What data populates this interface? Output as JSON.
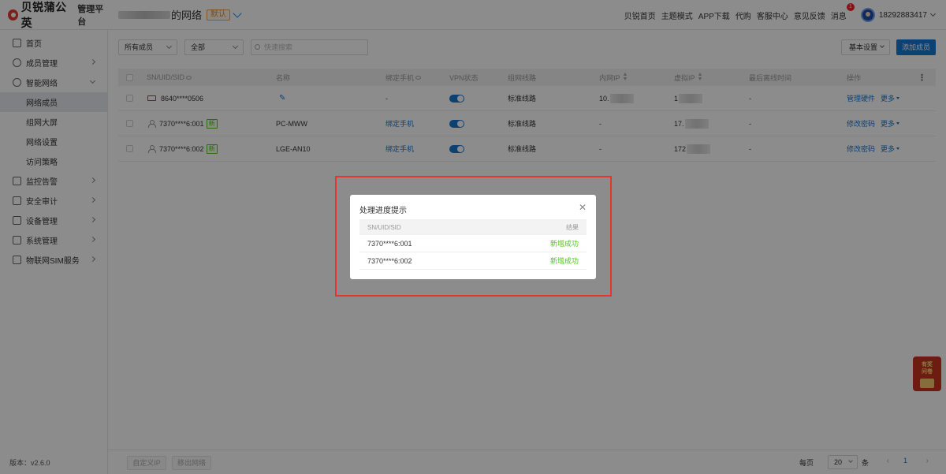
{
  "brand": {
    "logo_text": "贝锐蒲公英",
    "platform": "管理平台"
  },
  "header": {
    "network_suffix": "的网络",
    "default_tag": "默认",
    "links": [
      "贝锐首页",
      "主题模式",
      "APP下载",
      "代购",
      "客服中心",
      "意见反馈"
    ],
    "messages_label": "消息",
    "messages_count": "1",
    "phone": "18292883417"
  },
  "sidebar": {
    "items": [
      {
        "label": "首页",
        "icon": "home-icon"
      },
      {
        "label": "成员管理",
        "icon": "user-icon"
      },
      {
        "label": "智能网络",
        "icon": "network-icon"
      }
    ],
    "sub_items": [
      "网络成员",
      "组网大屏",
      "网络设置",
      "访问策略"
    ],
    "more_items": [
      {
        "label": "监控告警",
        "icon": "monitor-icon"
      },
      {
        "label": "安全审计",
        "icon": "audit-icon"
      },
      {
        "label": "设备管理",
        "icon": "device-icon"
      },
      {
        "label": "系统管理",
        "icon": "settings-icon"
      },
      {
        "label": "物联网SIM服务",
        "icon": "sim-icon"
      }
    ],
    "version": "版本：v2.6.0"
  },
  "toolbar": {
    "member_filter": "所有成员",
    "type_filter": "全部",
    "search_placeholder": "快速搜索",
    "basic_settings": "基本设置",
    "add_member": "添加成员"
  },
  "table": {
    "columns": [
      "SN/UID/SID",
      "名称",
      "绑定手机",
      "VPN状态",
      "组网线路",
      "内网IP",
      "虚拟IP",
      "最后离线时间",
      "操作"
    ],
    "rows": [
      {
        "id": "8640****0506",
        "name": "",
        "phone": "-",
        "route": "标准线路",
        "lan_ip": "10.",
        "vip": "1",
        "last_offline": "-",
        "action": "管理硬件",
        "more": "更多",
        "is_new": false
      },
      {
        "id": "7370****6:001",
        "name": "PC-MWW",
        "phone": "绑定手机",
        "route": "标准线路",
        "lan_ip": "-",
        "vip": "17.",
        "last_offline": "-",
        "action": "修改密码",
        "more": "更多",
        "is_new": true
      },
      {
        "id": "7370****6:002",
        "name": "LGE-AN10",
        "phone": "绑定手机",
        "route": "标准线路",
        "lan_ip": "-",
        "vip": "172",
        "last_offline": "-",
        "action": "修改密码",
        "more": "更多",
        "is_new": true
      }
    ],
    "new_tag": "新"
  },
  "footer": {
    "custom_ip": "自定义IP",
    "remove_network": "移出网络",
    "per_page_label": "每页",
    "per_page": "20",
    "unit": "条",
    "page": "1"
  },
  "modal": {
    "title": "处理进度提示",
    "col_id": "SN/UID/SID",
    "col_result": "结果",
    "rows": [
      {
        "id": "7370****6:001",
        "result": "新增成功"
      },
      {
        "id": "7370****6:002",
        "result": "新增成功"
      }
    ]
  },
  "promo": {
    "line1": "有奖",
    "line2": "问卷"
  },
  "colors": {
    "accent": "#1677cf",
    "success": "#52c41a",
    "brand_red": "#e63b2e",
    "highlight": "#e5362e"
  }
}
